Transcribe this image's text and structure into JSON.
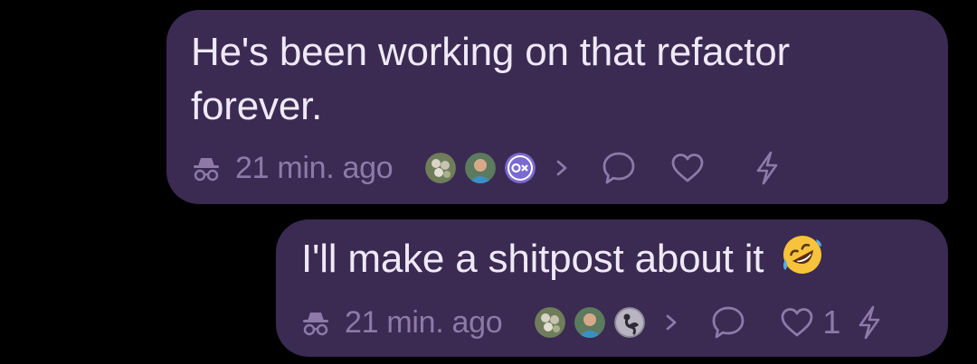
{
  "messages": [
    {
      "text": "He's been working on that refactor\nforever.",
      "timestamp": "21 min. ago",
      "avatars": [
        "avatar-flower-icon",
        "avatar-person-icon",
        "avatar-ox-icon"
      ],
      "likes": "",
      "emoji": ""
    },
    {
      "text": "I'll make a shitpost about it ",
      "timestamp": "21 min. ago",
      "avatars": [
        "avatar-flower-icon",
        "avatar-person-icon",
        "avatar-bird-icon"
      ],
      "likes": "1",
      "emoji": "rolling-on-floor-laughing-emoji"
    }
  ],
  "colors": {
    "background": "#000000",
    "bubble": "#3b2a52",
    "text": "#efe9f7",
    "meta": "#8d7aa8"
  },
  "icons": {
    "incognito": "incognito-icon",
    "expand": "chevron-right-icon",
    "reply": "speech-bubble-icon",
    "like": "heart-icon",
    "zap": "lightning-icon"
  }
}
